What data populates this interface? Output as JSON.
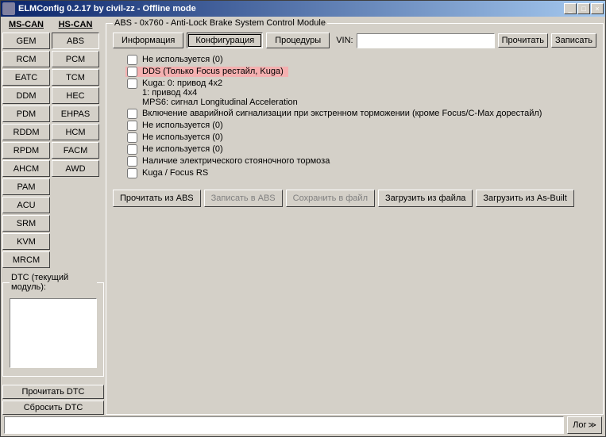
{
  "window": {
    "title": "ELMConfig 0.2.17 by civil-zz - Offline mode"
  },
  "sidebar": {
    "mscan": {
      "header": "MS-CAN",
      "items": [
        "GEM",
        "RCM",
        "EATC",
        "DDM",
        "PDM",
        "RDDM",
        "RPDM",
        "AHCM",
        "PAM",
        "ACU",
        "SRM",
        "KVM",
        "MRCM"
      ]
    },
    "hscan": {
      "header": "HS-CAN",
      "items": [
        "ABS",
        "PCM",
        "TCM",
        "HEC",
        "EHPAS",
        "HCM",
        "FACM",
        "AWD"
      ],
      "active": "ABS"
    }
  },
  "dtc": {
    "legend": "DTC (текущий модуль):",
    "read": "Прочитать DTC",
    "reset": "Сбросить DTC"
  },
  "module": {
    "legend": "ABS - 0x760 - Anti-Lock Brake System Control Module",
    "tabs": {
      "info": "Информация",
      "config": "Конфигурация",
      "proc": "Процедуры"
    },
    "vin_label": "VIN:",
    "vin_value": "",
    "read": "Прочитать",
    "write": "Записать"
  },
  "options": [
    {
      "label": "Не используется (0)",
      "checked": false
    },
    {
      "label": "DDS (Только Focus рестайл, Kuga)",
      "checked": false,
      "highlight": true
    },
    {
      "label": "Kuga: 0: привод 4x2\n           1: привод 4x4\nMPS6: сигнал Longitudinal Acceleration",
      "checked": false
    },
    {
      "label": "Включение аварийной сигнализации при экстренном торможении (кроме Focus/C-Max дорестайл)",
      "checked": false
    },
    {
      "label": "Не используется (0)",
      "checked": false
    },
    {
      "label": "Не используется (0)",
      "checked": false
    },
    {
      "label": "Не используется (0)",
      "checked": false
    },
    {
      "label": "Наличие электрического стояночного тормоза",
      "checked": false
    },
    {
      "label": "Kuga / Focus RS",
      "checked": false
    }
  ],
  "actions": {
    "read_abs": "Прочитать из ABS",
    "write_abs": "Записать в ABS",
    "save_file": "Сохранить в файл",
    "load_file": "Загрузить из файла",
    "load_asbuilt": "Загрузить из As-Built"
  },
  "bottom": {
    "status": "",
    "log": "Лог",
    "arrow": "≫"
  }
}
